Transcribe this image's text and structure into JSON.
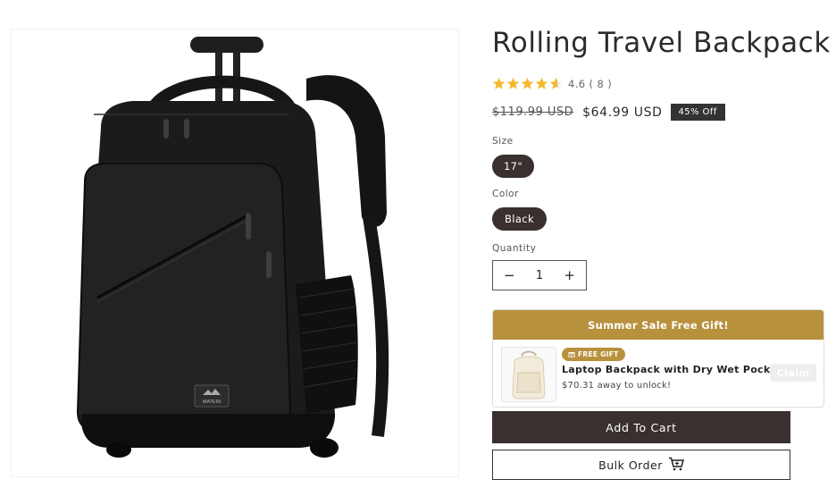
{
  "product": {
    "title": "Rolling Travel Backpack",
    "rating": {
      "value": 4.6,
      "stars_max": 5,
      "text": "4.6 ( 8 )"
    },
    "price": {
      "original": "$119.99 USD",
      "sale": "$64.99 USD",
      "badge": "45% Off"
    },
    "image_logo_text": "MATEIN"
  },
  "options": {
    "size_label": "Size",
    "size_value": "17\"",
    "color_label": "Color",
    "color_value": "Black"
  },
  "quantity": {
    "label": "Quantity",
    "value": "1",
    "minus": "−",
    "plus": "+"
  },
  "gift": {
    "header": "Summer Sale Free Gift!",
    "badge_icon": "gift-icon",
    "badge": "FREE GIFT",
    "name": "Laptop Backpack with Dry Wet Pocket",
    "subtitle": "$70.31 away to unlock!",
    "claim_label": "Claim"
  },
  "actions": {
    "add_to_cart": "Add To Cart",
    "bulk_order": "Bulk Order",
    "bulk_icon": "cart-icon"
  },
  "colors": {
    "star": "#f5b82e",
    "gift_accent": "#b8913d",
    "button_dark": "#3a3030"
  }
}
